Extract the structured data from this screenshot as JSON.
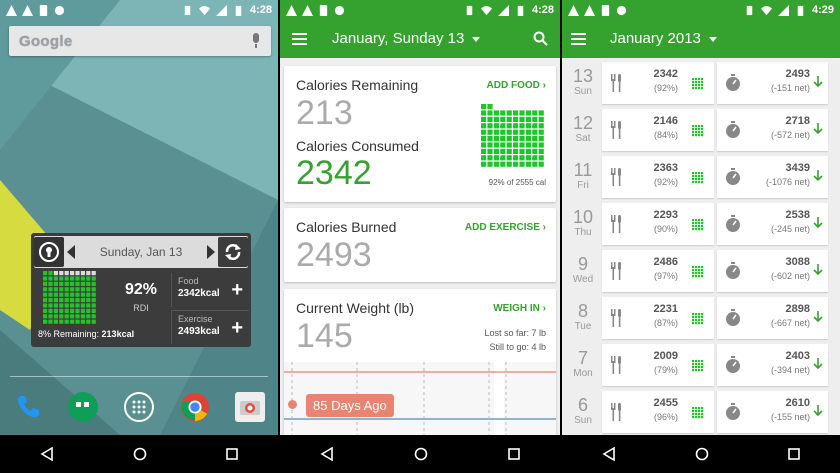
{
  "status": {
    "s1_time": "4:28",
    "s2_time": "4:28",
    "s3_time": "4:29"
  },
  "home": {
    "search_logo": "Google",
    "widget": {
      "date": "Sunday, Jan 13",
      "percent": "92%",
      "rdi_label": "RDI",
      "remaining_label": "8% Remaining: ",
      "remaining_value": "213kcal",
      "food_label": "Food",
      "food_value": "2342kcal",
      "exercise_label": "Exercise",
      "exercise_value": "2493kcal",
      "grid_filled_fraction": 0.92
    },
    "dock_apps": [
      "phone-icon",
      "hangouts-icon",
      "apps-icon",
      "chrome-icon",
      "camera-icon"
    ]
  },
  "diary": {
    "title": "January, Sunday 13",
    "calories_remaining_label": "Calories Remaining",
    "calories_remaining_value": "213",
    "add_food": "ADD FOOD",
    "calories_consumed_label": "Calories Consumed",
    "calories_consumed_value": "2342",
    "percent_note": "92% of 2555 cal",
    "calories_burned_label": "Calories Burned",
    "calories_burned_value": "2493",
    "add_exercise": "ADD EXERCISE",
    "weight_label": "Current Weight (lb)",
    "weight_value": "145",
    "weigh_in": "WEIGH IN",
    "lost_so_far": "Lost so far: 7 lb",
    "still_to_go": "Still to go: 4 lb",
    "days_ago_badge": "85 Days Ago",
    "grid_filled_fraction": 0.92
  },
  "month": {
    "title": "January 2013",
    "rows": [
      {
        "num": "13",
        "day": "Sun",
        "food": "2342",
        "food_pct": "(92%)",
        "ex": "2493",
        "net": "(-151 net)"
      },
      {
        "num": "12",
        "day": "Sat",
        "food": "2146",
        "food_pct": "(84%)",
        "ex": "2718",
        "net": "(-572 net)"
      },
      {
        "num": "11",
        "day": "Fri",
        "food": "2363",
        "food_pct": "(92%)",
        "ex": "3439",
        "net": "(-1076 net)"
      },
      {
        "num": "10",
        "day": "Thu",
        "food": "2293",
        "food_pct": "(90%)",
        "ex": "2538",
        "net": "(-245 net)"
      },
      {
        "num": "9",
        "day": "Wed",
        "food": "2486",
        "food_pct": "(97%)",
        "ex": "3088",
        "net": "(-602 net)"
      },
      {
        "num": "8",
        "day": "Tue",
        "food": "2231",
        "food_pct": "(87%)",
        "ex": "2898",
        "net": "(-667 net)"
      },
      {
        "num": "7",
        "day": "Mon",
        "food": "2009",
        "food_pct": "(79%)",
        "ex": "2403",
        "net": "(-394 net)"
      },
      {
        "num": "6",
        "day": "Sun",
        "food": "2455",
        "food_pct": "(96%)",
        "ex": "2610",
        "net": "(-155 net)"
      }
    ]
  },
  "colors": {
    "green": "#35a12f",
    "grid_green": "#22c42a",
    "coral": "#e8846f",
    "gray_text": "#aaaaaa"
  }
}
